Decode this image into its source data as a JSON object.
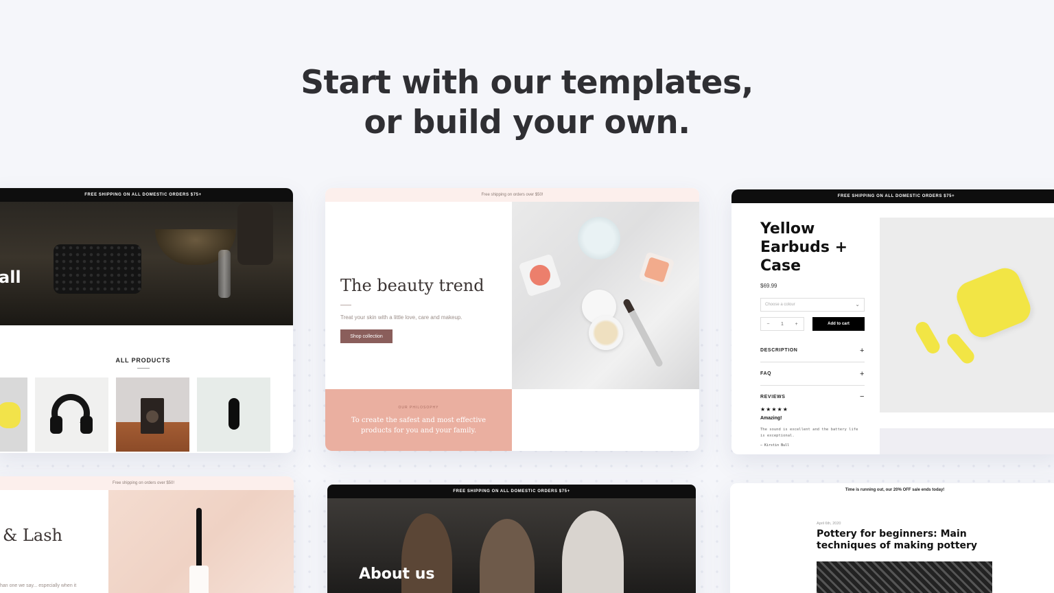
{
  "headline": {
    "line1": "Start with our templates,",
    "line2": "or build your own."
  },
  "card_electronics": {
    "banner": "FREE SHIPPING ON ALL DOMESTIC ORDERS $75+",
    "hero_text": "all",
    "section_title": "ALL PRODUCTS"
  },
  "card_beauty": {
    "banner": "Free shipping on orders over $50!",
    "title": "The beauty trend",
    "subtitle": "Treat your skin with a little love, care and makeup.",
    "button": "Shop collection",
    "philosophy_label": "OUR PHILOSOPHY",
    "philosophy_quote": "To create the safest and most effective products for you and your family."
  },
  "card_earbuds": {
    "banner": "FREE SHIPPING ON ALL DOMESTIC ORDERS $75+",
    "title": "Yellow Earbuds + Case",
    "price": "$69.99",
    "select_placeholder": "Choose a colour",
    "qty_minus": "−",
    "qty_value": "1",
    "qty_plus": "+",
    "add_to_cart": "Add to cart",
    "accordion": [
      {
        "label": "DESCRIPTION",
        "sign": "+"
      },
      {
        "label": "FAQ",
        "sign": "+"
      },
      {
        "label": "REVIEWS",
        "sign": "−"
      }
    ],
    "stars": "★★★★★",
    "review_title": "Amazing!",
    "review_body": "The sound is excellent and the battery life is exceptional.",
    "review_author": "— Kirstin Bull"
  },
  "card_lash": {
    "banner": "Free shipping on orders over $50!",
    "title": "& Lash",
    "subtitle": "han one we say... especially when it"
  },
  "card_about": {
    "banner": "FREE SHIPPING ON ALL DOMESTIC ORDERS $75+",
    "title": "About us"
  },
  "card_pottery": {
    "banner": "Time is running out, our 20% OFF sale ends today!",
    "date": "April 6th, 2020",
    "title": "Pottery for beginners: Main techniques of making pottery"
  },
  "colors": {
    "page_bg": "#f5f6fa",
    "headline": "#2f2f33",
    "beauty_button": "#8a5e5b",
    "beauty_pink": "#eaafa0",
    "earbuds_yellow": "#f2e545"
  }
}
